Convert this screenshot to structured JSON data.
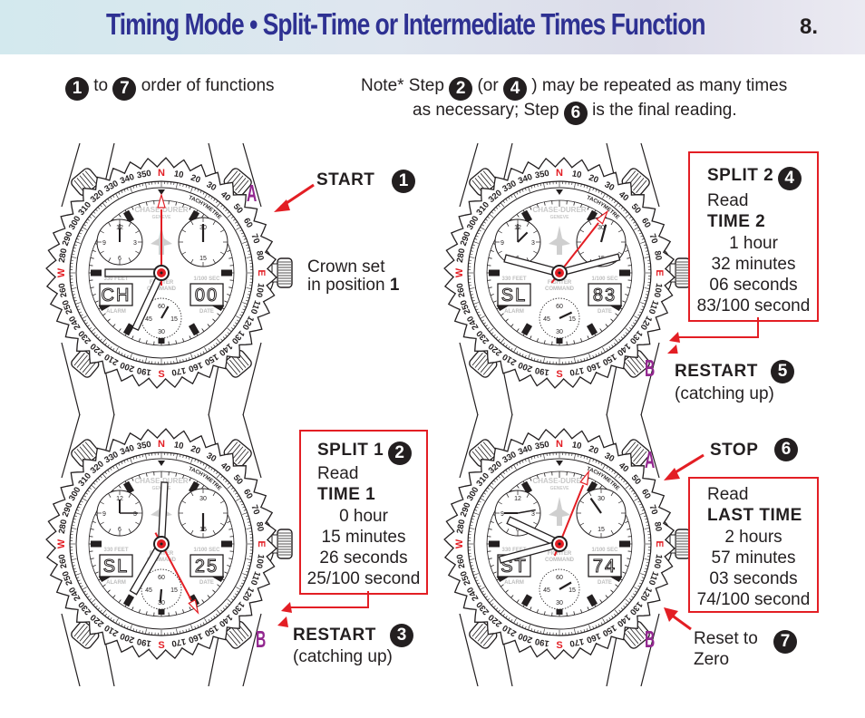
{
  "header": {
    "title": "Timing Mode • Split-Time or Intermediate Times Function",
    "page_number": "8."
  },
  "legend": {
    "badge_from": "1",
    "to_text": "to",
    "badge_to": "7",
    "suffix": "order of functions"
  },
  "note": {
    "line1_prefix": "Note* Step",
    "badge_a": "2",
    "or_text": "(or",
    "badge_b": "4",
    "line1_suffix": ") may be repeated as many times",
    "line2_prefix": "as necessary; Step",
    "badge_c": "6",
    "line2_suffix": "is the final reading."
  },
  "colors": {
    "title_blue": "#2e3192",
    "accent_red": "#e31e24",
    "button_purple": "#92278f",
    "ink": "#231f20"
  },
  "watch_face": {
    "brand": "CHASE-DURER",
    "city": "GENEVE",
    "model_line1": "FIGHTER",
    "model_line2": "COMMAND",
    "tachymetre": "TACHYMETRE",
    "left_window_label_top": "330 FEET",
    "left_window_label_bottom": "ALARM",
    "right_window_label_top": "1/100 SEC",
    "right_window_label_bottom": "DATE",
    "compass": {
      "N": "N",
      "E": "E",
      "S": "S",
      "W": "W"
    },
    "bezel_numbers": [
      "10",
      "20",
      "30",
      "40",
      "50",
      "60",
      "70",
      "80",
      "100",
      "110",
      "120",
      "130",
      "140",
      "150",
      "160",
      "170",
      "190",
      "200",
      "210",
      "220",
      "230",
      "240",
      "250",
      "260",
      "280",
      "290",
      "300",
      "310",
      "320",
      "330",
      "340",
      "350"
    ],
    "left_subdial_numbers": [
      "12",
      "3",
      "6",
      "9"
    ],
    "right_subdial_numbers": [
      "30",
      "15"
    ],
    "bottom_subdial_numbers": [
      "60",
      "15",
      "30",
      "45"
    ]
  },
  "panels": [
    {
      "id": "step1",
      "display_left": "CH",
      "display_right": "00",
      "button_top_label": "A",
      "action_label": "START",
      "action_badge": "1",
      "crown_note_line1": "Crown set",
      "crown_note_line2_prefix": "in position",
      "crown_note_position": "1"
    },
    {
      "id": "step4",
      "display_left": "SL",
      "display_right": "83",
      "button_bottom_label": "B",
      "box_title": "SPLIT 2",
      "box_badge": "4",
      "box_read": "Read",
      "box_time_label": "TIME 2",
      "box_values": [
        "1 hour",
        "32 minutes",
        "06 seconds",
        "83/100 second"
      ],
      "action_label": "RESTART",
      "action_badge": "5",
      "action_sub": "(catching up)"
    },
    {
      "id": "step2",
      "display_left": "SL",
      "display_right": "25",
      "button_bottom_label": "B",
      "box_title": "SPLIT 1",
      "box_badge": "2",
      "box_read": "Read",
      "box_time_label": "TIME 1",
      "box_values": [
        "0 hour",
        "15 minutes",
        "26 seconds",
        "25/100 second"
      ],
      "action_label": "RESTART",
      "action_badge": "3",
      "action_sub": "(catching up)"
    },
    {
      "id": "step6",
      "display_left": "ST",
      "display_right": "74",
      "button_top_label": "A",
      "button_bottom_label": "B",
      "action_label": "STOP",
      "action_badge": "6",
      "box_read": "Read",
      "box_time_label": "LAST TIME",
      "box_values": [
        "2 hours",
        "57 minutes",
        "03 seconds",
        "74/100 second"
      ],
      "reset_line1": "Reset to",
      "reset_line2": "Zero",
      "reset_badge": "7"
    }
  ],
  "watch_states": [
    {
      "hour_hand_deg": 270,
      "minute_hand_deg": 205,
      "chrono_second_deg": 0,
      "right_sub_deg": 0,
      "bottom_sub_deg": 30,
      "left_sub_hour_deg": 0,
      "left_sub_min_deg": 0
    },
    {
      "hour_hand_deg": 285,
      "minute_hand_deg": 75,
      "chrono_second_deg": 38,
      "right_sub_deg": 15,
      "bottom_sub_deg": 65,
      "left_sub_hour_deg": 45,
      "left_sub_min_deg": 0
    },
    {
      "hour_hand_deg": 210,
      "minute_hand_deg": 3,
      "chrono_second_deg": 152,
      "right_sub_deg": 180,
      "bottom_sub_deg": 185,
      "left_sub_hour_deg": 0,
      "left_sub_min_deg": 90
    },
    {
      "hour_hand_deg": 295,
      "minute_hand_deg": 255,
      "chrono_second_deg": 22,
      "right_sub_deg": 325,
      "bottom_sub_deg": 60,
      "left_sub_hour_deg": 270,
      "left_sub_min_deg": 80
    }
  ]
}
